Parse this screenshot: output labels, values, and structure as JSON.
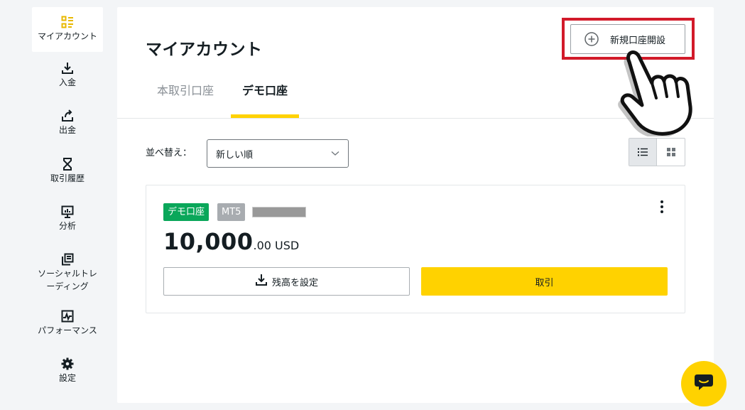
{
  "sidebar": {
    "items": [
      {
        "label": "マイアカウント",
        "icon": "dashboard-icon",
        "active": true
      },
      {
        "label": "入金",
        "icon": "download-icon"
      },
      {
        "label": "出金",
        "icon": "upload-icon"
      },
      {
        "label": "取引履歴",
        "icon": "hourglass-icon"
      },
      {
        "label": "分析",
        "icon": "analytics-icon"
      },
      {
        "label": "ソーシャルトレーディング",
        "line1": "ソーシャルトレ",
        "line2": "ーディング",
        "icon": "copy-icon"
      },
      {
        "label": "パフォーマンス",
        "icon": "performance-icon"
      },
      {
        "label": "設定",
        "icon": "gear-icon"
      }
    ]
  },
  "main": {
    "title": "マイアカウント",
    "new_account_label": "新規口座開設",
    "tabs": [
      {
        "label": "本取引口座",
        "active": false
      },
      {
        "label": "デモ口座",
        "active": true
      }
    ],
    "sort": {
      "label": "並べ替え：",
      "value": "新しい順"
    },
    "view_modes": [
      "list",
      "grid"
    ],
    "active_view": "list"
  },
  "account_card": {
    "type_badge": "デモ口座",
    "platform_badge": "MT5",
    "balance_main": "10,000",
    "balance_decimals": ".00",
    "currency": "USD",
    "set_balance_label": "残高を設定",
    "trade_label": "取引"
  },
  "colors": {
    "accent": "#ffd200",
    "demo_badge": "#0aa75a",
    "mt5_badge": "#a8acb0",
    "highlight": "#d21a2a"
  }
}
